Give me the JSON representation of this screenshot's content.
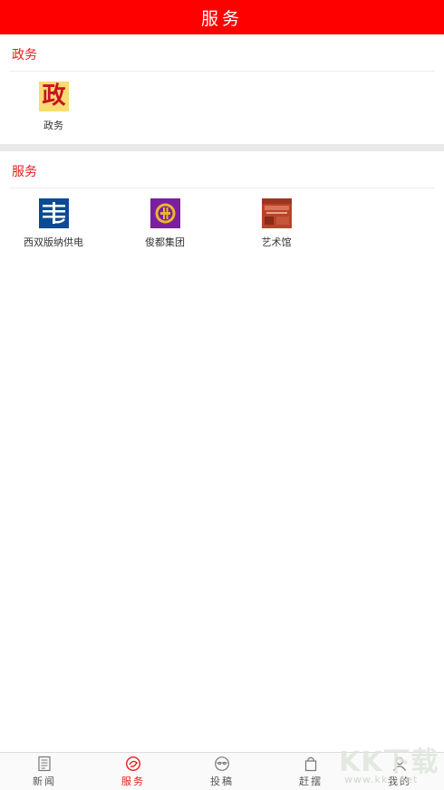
{
  "header": {
    "title": "服务"
  },
  "sections": [
    {
      "label": "政务",
      "items": [
        {
          "name": "政务",
          "icon": "zhengwu-icon",
          "icon_glyph": "政",
          "color": "#f5d96b"
        }
      ]
    },
    {
      "label": "服务",
      "items": [
        {
          "name": "西双版纳供电",
          "icon": "power-grid-icon",
          "color": "#0a4b93"
        },
        {
          "name": "俊都集团",
          "icon": "jundu-logo-icon",
          "color": "#7b1fa2"
        },
        {
          "name": "艺术馆",
          "icon": "art-museum-icon",
          "color": "#b8432a"
        }
      ]
    }
  ],
  "tabbar": {
    "tabs": [
      {
        "label": "新闻",
        "icon": "newspaper-icon"
      },
      {
        "label": "服务",
        "icon": "service-icon",
        "active": true
      },
      {
        "label": "投稿",
        "icon": "submit-icon"
      },
      {
        "label": "赶摆",
        "icon": "shopping-bag-icon"
      },
      {
        "label": "我的",
        "icon": "user-icon"
      }
    ]
  },
  "watermark": {
    "main": "KK下载",
    "sub": "www.kkx.net"
  },
  "colors": {
    "accent": "#ff0000",
    "section_label": "#e02020"
  }
}
